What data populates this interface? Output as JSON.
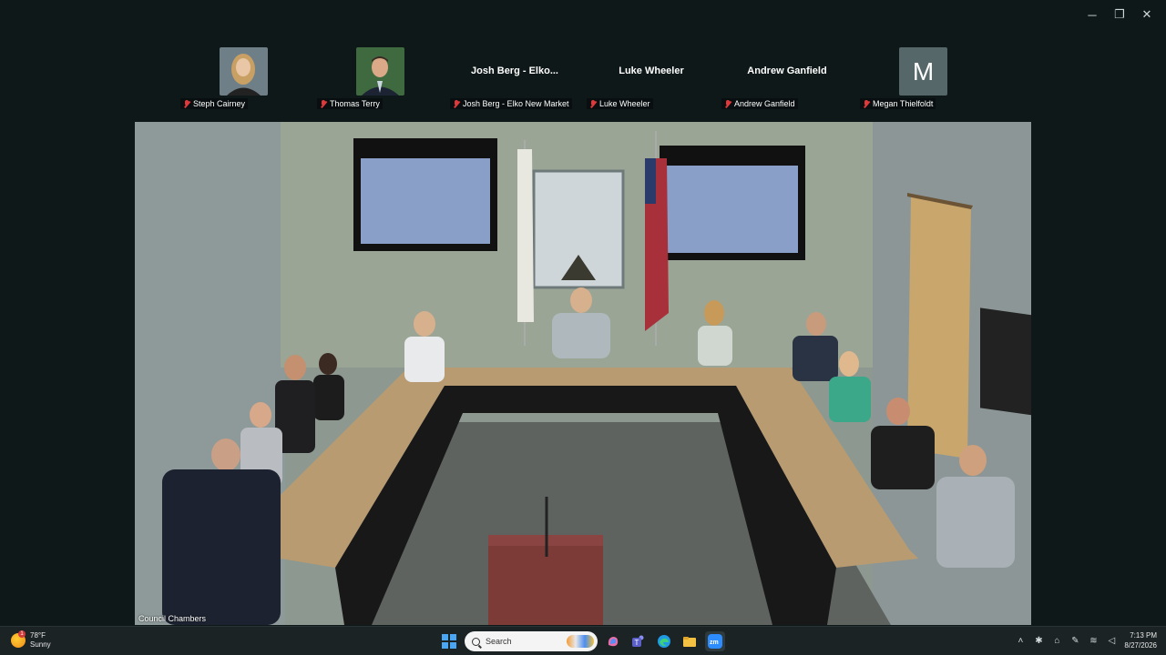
{
  "window": {
    "controls": {
      "minimize": "─",
      "restore": "❐",
      "close": "✕"
    }
  },
  "participants": [
    {
      "name": "Steph Cairney",
      "has_photo": true,
      "tile_title": ""
    },
    {
      "name": "Thomas Terry",
      "has_photo": true,
      "tile_title": ""
    },
    {
      "name": "Josh Berg - Elko New Market",
      "has_photo": false,
      "tile_title": "Josh Berg - Elko..."
    },
    {
      "name": "Luke Wheeler",
      "has_photo": false,
      "tile_title": "Luke Wheeler"
    },
    {
      "name": "Andrew Ganfield",
      "has_photo": false,
      "tile_title": "Andrew Ganfield"
    },
    {
      "name": "Megan Thielfoldt",
      "has_photo": false,
      "avatar_letter": "M",
      "tile_title": ""
    }
  ],
  "main_video": {
    "room_label": "Council Chambers"
  },
  "taskbar": {
    "weather": {
      "badge": "1",
      "temp": "78°F",
      "condition": "Sunny"
    },
    "search_placeholder": "Search",
    "clock": {
      "time": "7:13 PM",
      "date": "8/27/2026"
    }
  },
  "colors": {
    "background": "#0f1819",
    "mic_muted": "#e0393c",
    "taskbar": "#1b2325"
  }
}
